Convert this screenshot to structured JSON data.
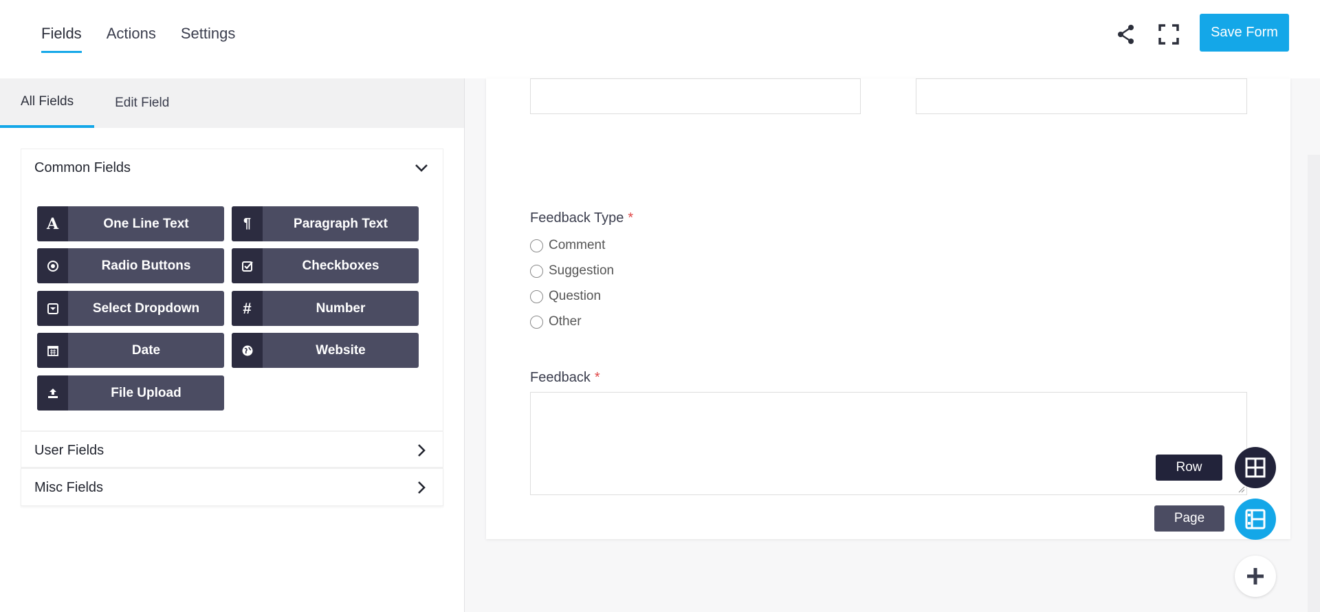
{
  "topnav": {
    "tabs": [
      "Fields",
      "Actions",
      "Settings"
    ],
    "active": "Fields"
  },
  "toolbar": {
    "save_label": "Save Form"
  },
  "left_tabs": [
    "All Fields",
    "Edit Field"
  ],
  "groups": {
    "common": {
      "title": "Common Fields",
      "fields": [
        "One Line Text",
        "Paragraph Text",
        "Radio Buttons",
        "Checkboxes",
        "Select Dropdown",
        "Number",
        "Date",
        "Website",
        "File Upload"
      ]
    },
    "user": {
      "title": "User Fields"
    },
    "misc": {
      "title": "Misc Fields"
    }
  },
  "form": {
    "feedback_type": {
      "label": "Feedback Type",
      "required_mark": "*",
      "options": [
        "Comment",
        "Suggestion",
        "Question",
        "Other"
      ]
    },
    "feedback": {
      "label": "Feedback",
      "required_mark": "*"
    }
  },
  "fab": {
    "row_label": "Row",
    "page_label": "Page"
  },
  "colors": {
    "accent": "#14a7e8",
    "button_dark": "#4b4c62",
    "icon_dark": "#2c2c40",
    "required": "#e04848"
  }
}
